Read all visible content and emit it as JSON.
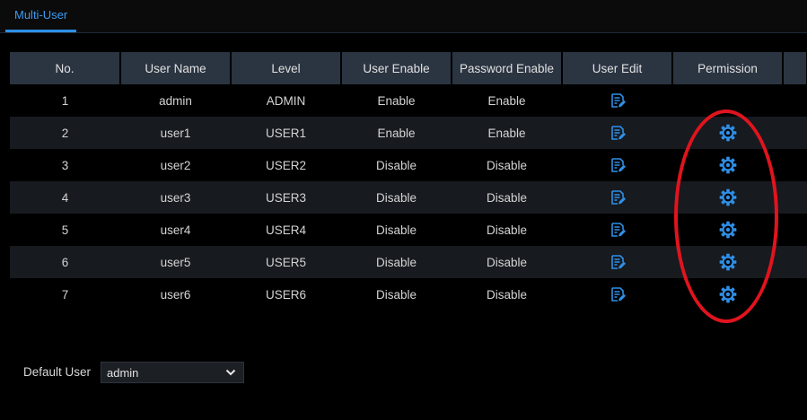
{
  "tab": {
    "label": "Multi-User"
  },
  "table": {
    "headers": [
      "No.",
      "User Name",
      "Level",
      "User Enable",
      "Password Enable",
      "User Edit",
      "Permission",
      ""
    ],
    "rows": [
      {
        "no": "1",
        "name": "admin",
        "level": "ADMIN",
        "user_enable": "Enable",
        "password_enable": "Enable",
        "edit_icon": "edit-icon",
        "permission_icon": ""
      },
      {
        "no": "2",
        "name": "user1",
        "level": "USER1",
        "user_enable": "Enable",
        "password_enable": "Enable",
        "edit_icon": "edit-icon",
        "permission_icon": "gear-icon"
      },
      {
        "no": "3",
        "name": "user2",
        "level": "USER2",
        "user_enable": "Disable",
        "password_enable": "Disable",
        "edit_icon": "edit-icon",
        "permission_icon": "gear-icon"
      },
      {
        "no": "4",
        "name": "user3",
        "level": "USER3",
        "user_enable": "Disable",
        "password_enable": "Disable",
        "edit_icon": "edit-icon",
        "permission_icon": "gear-icon"
      },
      {
        "no": "5",
        "name": "user4",
        "level": "USER4",
        "user_enable": "Disable",
        "password_enable": "Disable",
        "edit_icon": "edit-icon",
        "permission_icon": "gear-icon"
      },
      {
        "no": "6",
        "name": "user5",
        "level": "USER5",
        "user_enable": "Disable",
        "password_enable": "Disable",
        "edit_icon": "edit-icon",
        "permission_icon": "gear-icon"
      },
      {
        "no": "7",
        "name": "user6",
        "level": "USER6",
        "user_enable": "Disable",
        "password_enable": "Disable",
        "edit_icon": "edit-icon",
        "permission_icon": "gear-icon"
      }
    ]
  },
  "default_user": {
    "label": "Default User",
    "value": "admin",
    "chevron_icon": "chevron-down-icon"
  },
  "colors": {
    "accent": "#2f8fe6",
    "header_bg": "#2b3441",
    "row_alt_bg": "#171a1f",
    "annotation": "#e0141e"
  }
}
